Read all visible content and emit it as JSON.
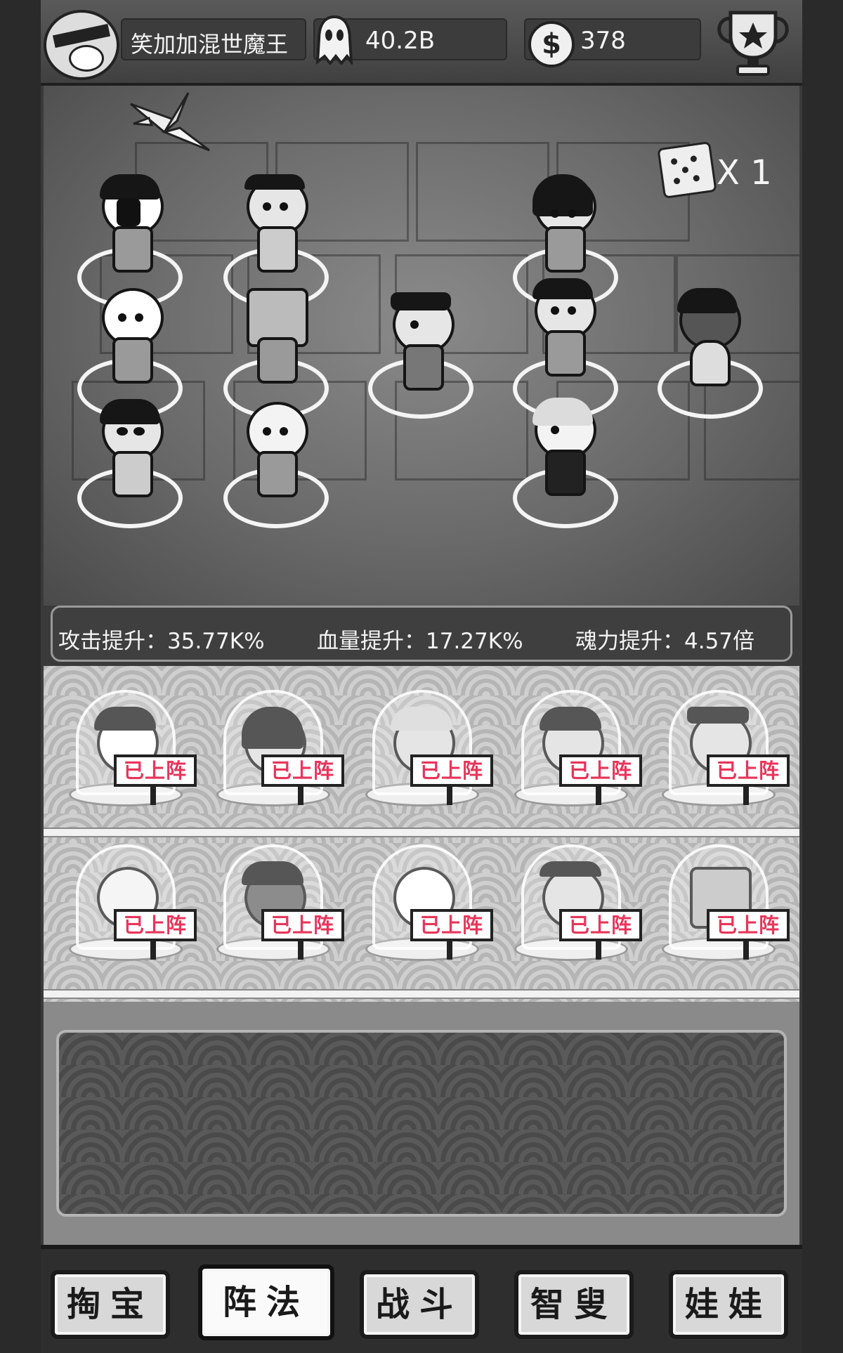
{
  "header": {
    "player_name": "笑加加混世魔王",
    "souls": "40.2B",
    "coins": "378",
    "icons": [
      "ninja-avatar-icon",
      "ghost-icon",
      "coin-icon",
      "trophy-icon"
    ]
  },
  "board": {
    "dice_count": "X 1",
    "icons": [
      "paper-crane-icon",
      "dice-icon"
    ]
  },
  "stats": {
    "attack": "攻击提升：35.77K%",
    "hp": "血量提升：17.27K%",
    "soul": "魂力提升：4.57倍"
  },
  "roster": {
    "deployed_label": "已上阵",
    "rows": [
      [
        "已上阵",
        "已上阵",
        "已上阵",
        "已上阵",
        "已上阵"
      ],
      [
        "已上阵",
        "已上阵",
        "已上阵",
        "已上阵",
        "已上阵"
      ]
    ]
  },
  "nav": {
    "tabs": [
      "掏宝",
      "阵法",
      "战斗",
      "智叟",
      "娃娃"
    ],
    "active": "阵法"
  },
  "colors": {
    "deployed_text": "#e8355a",
    "background": "#3a3a3a"
  }
}
